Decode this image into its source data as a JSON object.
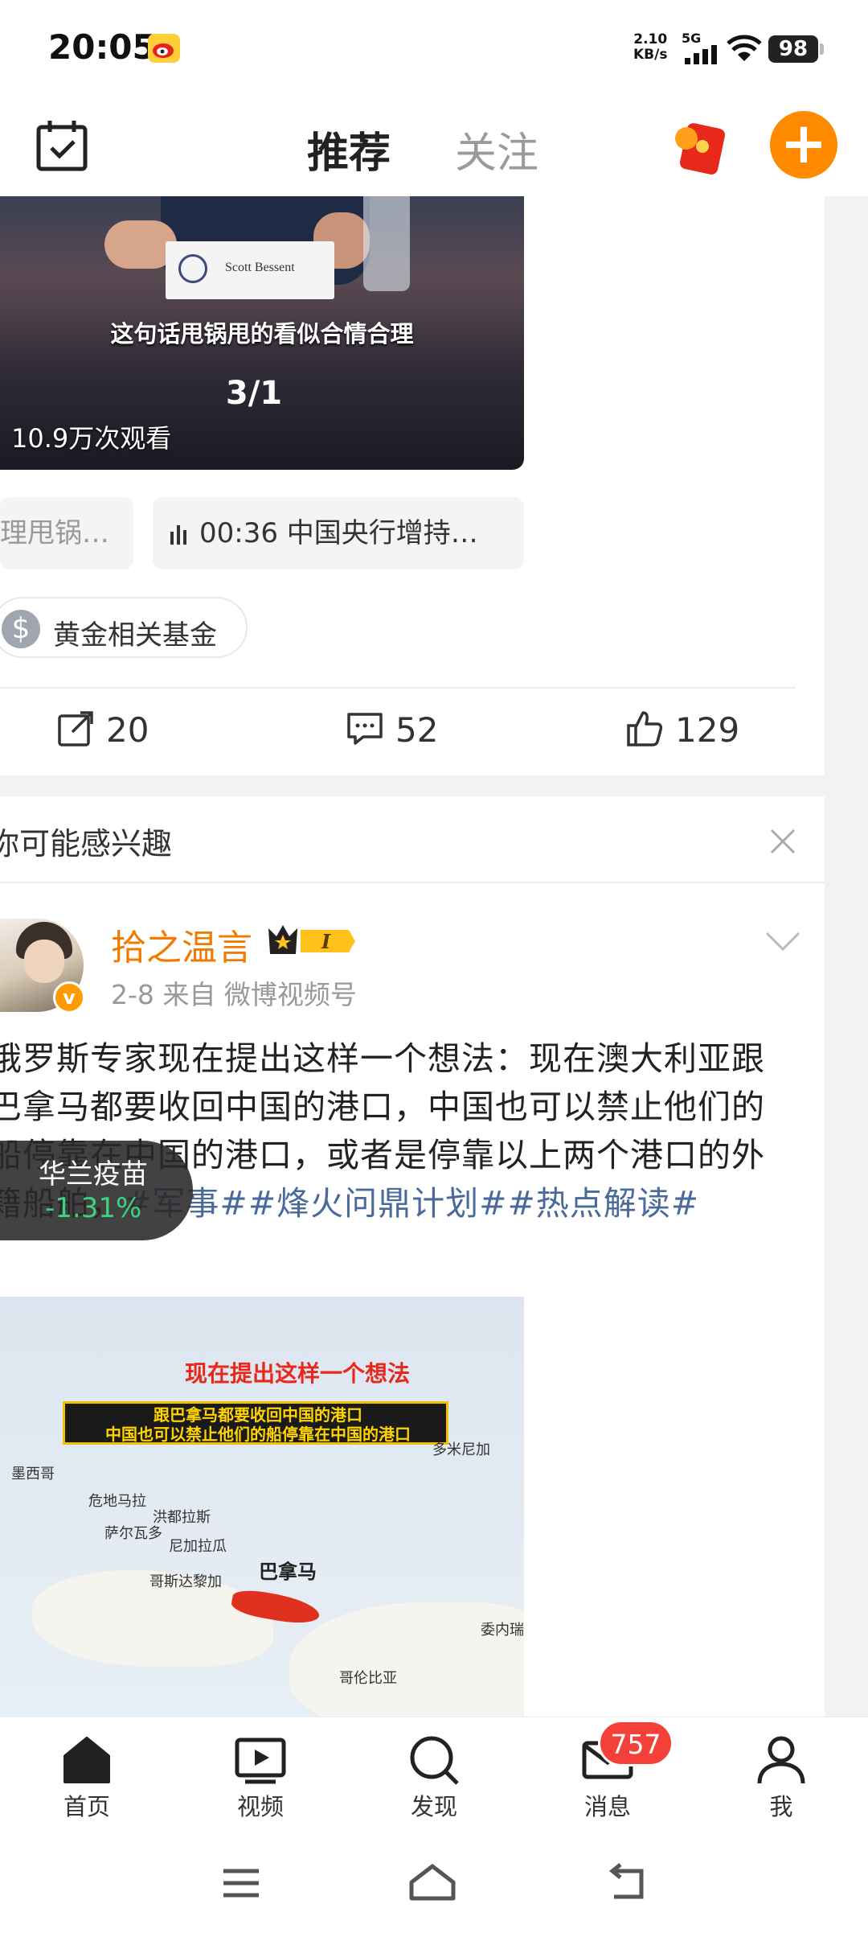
{
  "status_bar": {
    "time": "20:05",
    "net_speed_value": "2.10",
    "net_speed_unit": "KB/s",
    "network": "5G",
    "battery": "98"
  },
  "header": {
    "tabs": [
      {
        "label": "推荐",
        "active": true
      },
      {
        "label": "关注",
        "active": false
      }
    ],
    "plus_label": "+"
  },
  "post1": {
    "video_nameplate": "Scott Bessent",
    "video_caption": "这句话甩锅甩的看似合情合理",
    "video_page": "3/1",
    "views": "10.9万次观看",
    "chip_prev": "理甩锅…",
    "chip_audio": "00:36  中国央行增持…",
    "fund_tag": "黄金相关基金",
    "fund_icon": "$",
    "actions": {
      "repost": "20",
      "comment": "52",
      "like": "129"
    }
  },
  "suggest": {
    "title": "你可能感兴趣"
  },
  "post2": {
    "author": "拾之温言",
    "verified_badge": "v",
    "level_badge": "I",
    "meta": "2-8  来自 微博视频号",
    "body_text": "俄罗斯专家现在提出这样一个想法：现在澳大利亚跟巴拿马都要收回中国的港口，中国也可以禁止他们的船停靠在中国的港口，或者是停靠以上两个港口的外籍船舶，",
    "hashtags": [
      "#军事#",
      "#烽火问鼎计划#",
      "#热点解读#"
    ],
    "media": {
      "headline": "现在提出这样一个想法",
      "banner_line1": "跟巴拿马都要收回中国的港口",
      "banner_line2": "中国也可以禁止他们的船停靠在中国的港口",
      "map_labels": [
        "墨西哥",
        "危地马拉",
        "洪都拉斯",
        "萨尔瓦多",
        "尼加拉瓜",
        "哥斯达黎加",
        "巴拿马",
        "多米尼加",
        "委内瑞",
        "哥伦比亚"
      ]
    },
    "stock": {
      "name": "华兰疫苗",
      "change": "-1.31%"
    }
  },
  "tabbar": {
    "items": [
      {
        "label": "首页",
        "icon": "home-icon"
      },
      {
        "label": "视频",
        "icon": "video-icon"
      },
      {
        "label": "发现",
        "icon": "search-icon"
      },
      {
        "label": "消息",
        "icon": "message-icon"
      },
      {
        "label": "我",
        "icon": "profile-icon"
      }
    ],
    "message_badge": "757"
  },
  "colors": {
    "accent_orange": "#ff8a00",
    "author_orange": "#f27a00",
    "hashtag_blue": "#4a6b9a",
    "tab_underline": "#ffb000",
    "badge_red": "#f5403a",
    "stock_green": "#3fd080"
  }
}
